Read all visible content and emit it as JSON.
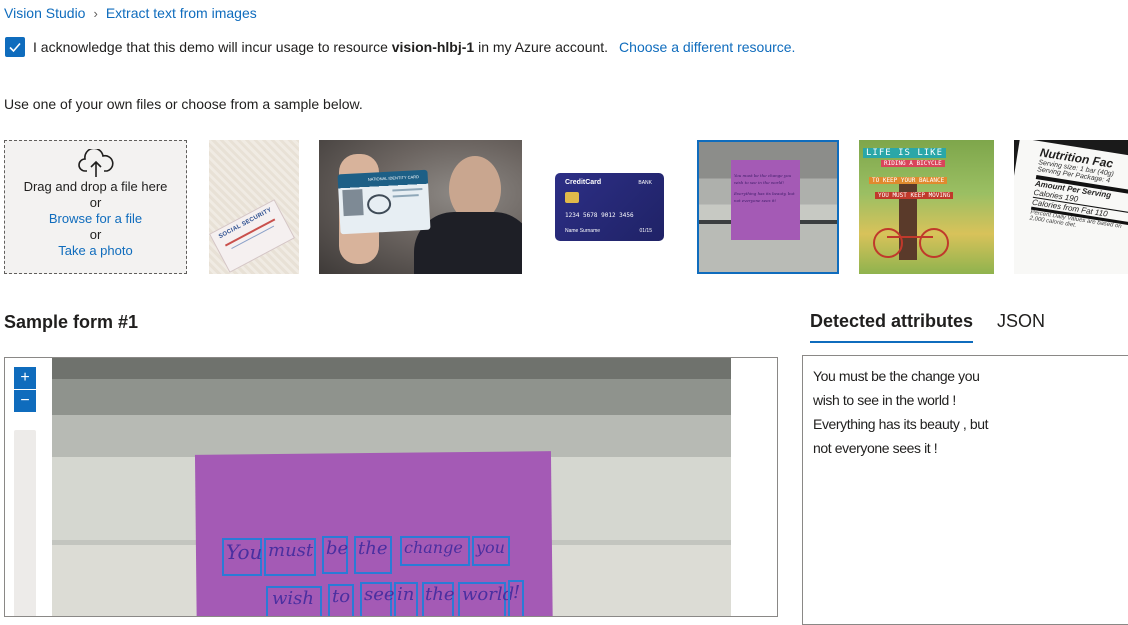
{
  "breadcrumb": {
    "root": "Vision Studio",
    "separator": "›",
    "current": "Extract text from images"
  },
  "acknowledge": {
    "checked": true,
    "text_before": "I acknowledge that this demo will incur usage to resource ",
    "resource": "vision-hlbj-1",
    "text_after": " in my Azure account.",
    "link": "Choose a different resource."
  },
  "instruction": "Use one of your own files or choose from a sample below.",
  "upload": {
    "drag_text": "Drag and drop a file here",
    "or1": "or",
    "browse": "Browse for a file",
    "or2": "or",
    "photo": "Take a photo"
  },
  "samples": {
    "social_security": {
      "title": "SOCIAL SECURITY"
    },
    "id_card": {
      "title": "NATIONAL IDENTITY CARD"
    },
    "credit_card": {
      "brand": "CreditCard",
      "bank": "BANK",
      "number": "1234 5678 9012 3456",
      "name": "Name Surname",
      "expiry": "01/15"
    },
    "note": {
      "line1": "You must be the change you",
      "line2": "wish to see in the world!",
      "line3": "Everything has its beauty, but",
      "line4": "not everyone sees it!"
    },
    "poster": {
      "line1": "LIFE IS LIKE",
      "line2": "RIDING A BICYCLE",
      "line3": "TO KEEP YOUR BALANCE",
      "line4": "YOU MUST KEEP MOVING"
    },
    "nutrition": {
      "title": "Nutrition Fac",
      "serving1": "Serving size: 1 bar (40g)",
      "serving2": "Serving Per Package: 4",
      "amount": "Amount Per Serving",
      "calories": "Calories 190",
      "fat": "Calories from Fat 110",
      "daily1": "Percent Daily Values are based on",
      "daily2": "2,000 calorie diet.",
      "side": "S"
    }
  },
  "form_title": "Sample form #1",
  "tabs": {
    "attributes": "Detected attributes",
    "json": "JSON"
  },
  "zoom": {
    "in": "+",
    "out": "−"
  },
  "handwriting": {
    "row1": [
      "You",
      "must",
      "be",
      "the",
      "change",
      "you"
    ],
    "row2": [
      "wish",
      "to",
      "see",
      "in",
      "the",
      "world",
      "!"
    ]
  },
  "results": [
    "You must be the change you",
    "wish to see in the world !",
    "Everything has its beauty , but",
    "not everyone sees it !"
  ],
  "colors": {
    "accent": "#0f6cbd",
    "note": "#a45ab5"
  },
  "icons": [
    "chevron-right-icon",
    "checkmark-icon",
    "cloud-upload-icon"
  ]
}
